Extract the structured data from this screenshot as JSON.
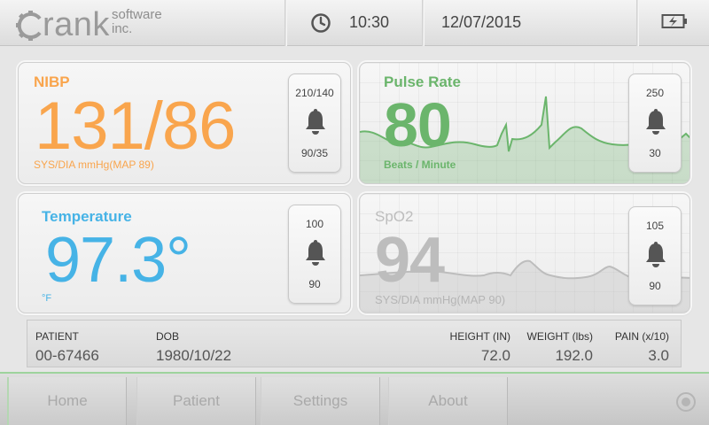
{
  "header": {
    "logo": {
      "brand": "Crank",
      "sub_line1": "software",
      "sub_line2": "inc."
    },
    "time": "10:30",
    "date": "12/07/2015",
    "icons": {
      "clock": "clock-icon",
      "battery": "battery-charging-icon"
    }
  },
  "panels": {
    "nibp": {
      "title": "NIBP",
      "value": "131/86",
      "unit": "SYS/DIA mmHg(MAP 89)",
      "alarm": {
        "high": "210/140",
        "low": "90/35"
      },
      "color": "#f9a54d"
    },
    "pulse": {
      "title": "Pulse Rate",
      "value": "80",
      "unit": "Beats / Minute",
      "alarm": {
        "high": "250",
        "low": "30"
      },
      "color": "#6bb56c"
    },
    "temperature": {
      "title": "Temperature",
      "value": "97.3°",
      "unit": "°F",
      "alarm": {
        "high": "100",
        "low": "90"
      },
      "color": "#46b3e6"
    },
    "spo2": {
      "title": "SpO2",
      "value": "94",
      "unit": "SYS/DIA mmHg(MAP 90)",
      "alarm": {
        "high": "105",
        "low": "90"
      },
      "color": "#bdbdbd"
    }
  },
  "patient": {
    "patient_label": "PATIENT",
    "patient_value": "00-67466",
    "dob_label": "DOB",
    "dob_value": "1980/10/22",
    "height_label": "HEIGHT (IN)",
    "height_value": "72.0",
    "weight_label": "WEIGHT (lbs)",
    "weight_value": "192.0",
    "pain_label": "PAIN (x/10)",
    "pain_value": "3.0"
  },
  "nav": {
    "items": [
      {
        "label": "Home"
      },
      {
        "label": "Patient"
      },
      {
        "label": "Settings"
      },
      {
        "label": "About"
      }
    ],
    "accent": "#9ed39d"
  }
}
